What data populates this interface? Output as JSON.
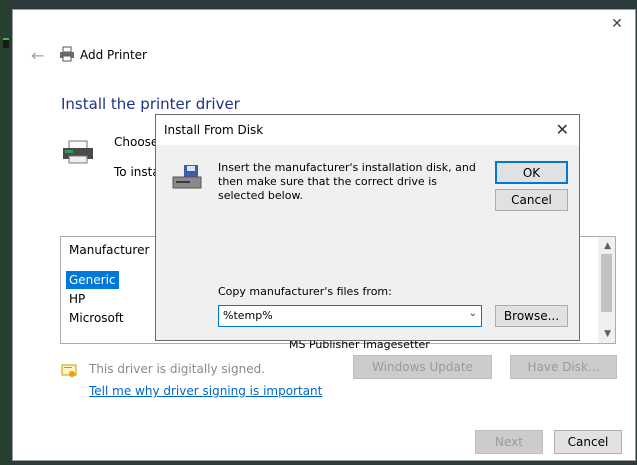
{
  "wizard": {
    "title": "Add Printer",
    "heading": "Install the printer driver",
    "choose_text": "Choose",
    "to_install_text": "To instal",
    "list": {
      "header": "Manufacturer",
      "items": [
        "Generic",
        "HP",
        "Microsoft"
      ],
      "selected": "Generic",
      "partial_item": "MS Publisher Imagesetter"
    },
    "signed_text": "This driver is digitally signed.",
    "link_text": "Tell me why driver signing is important",
    "windows_update_label": "Windows Update",
    "have_disk_label": "Have Disk...",
    "next_label": "Next",
    "cancel_label": "Cancel"
  },
  "dialog": {
    "title": "Install From Disk",
    "message": "Insert the manufacturer's installation disk, and then make sure that the correct drive is selected below.",
    "ok_label": "OK",
    "cancel_label": "Cancel",
    "copy_label": "Copy manufacturer's files from:",
    "path_value": "%temp%",
    "browse_label": "Browse..."
  },
  "icons": {
    "back": "back-arrow-icon",
    "printer": "printer-icon",
    "disk": "disk-drive-icon",
    "certificate": "certificate-icon",
    "close": "close-icon",
    "dropdown": "chevron-down-icon"
  },
  "colors": {
    "heading": "#1e3287",
    "selection": "#0078d7",
    "link": "#0066cc"
  }
}
